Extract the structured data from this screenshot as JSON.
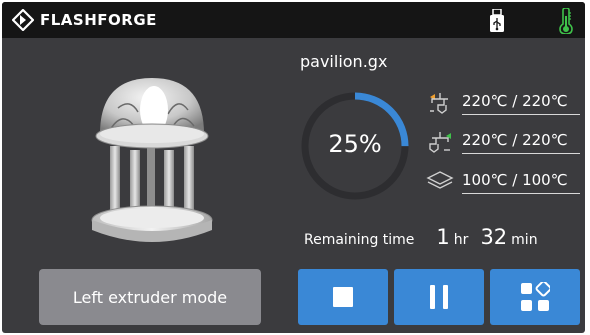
{
  "header": {
    "brand": "FLASHFORGE",
    "icons": [
      "flashforge-logo-icon",
      "usb-drive-icon",
      "thermometer-icon"
    ],
    "usb_color": "#ffffff",
    "thermometer_color": "#3fc24a"
  },
  "job": {
    "filename": "pavilion.gx",
    "progress_label": "25%",
    "progress": 0.25,
    "ring_color": "#3a88d6",
    "ring_track_color": "#2d2d30",
    "model_image": "pavilion-3d-model-icon"
  },
  "temperatures": [
    {
      "icon": "left-nozzle-icon",
      "indicator_color": "#f0a030",
      "value": "220℃ / 220℃"
    },
    {
      "icon": "right-nozzle-icon",
      "indicator_color": "#3fc24a",
      "value": "220℃ / 220℃"
    },
    {
      "icon": "heated-bed-icon",
      "value": "100℃ / 100℃"
    }
  ],
  "remaining": {
    "label": "Remaining time",
    "hours": "1",
    "hours_unit": "hr",
    "minutes": "32",
    "minutes_unit": "min"
  },
  "buttons": {
    "mode_label": "Left extruder mode",
    "stop_icon": "stop-icon",
    "pause_icon": "pause-icon",
    "menu_icon": "menu-grid-icon",
    "accent": "#3a88d6",
    "mode_bg": "#8a8a8f"
  }
}
